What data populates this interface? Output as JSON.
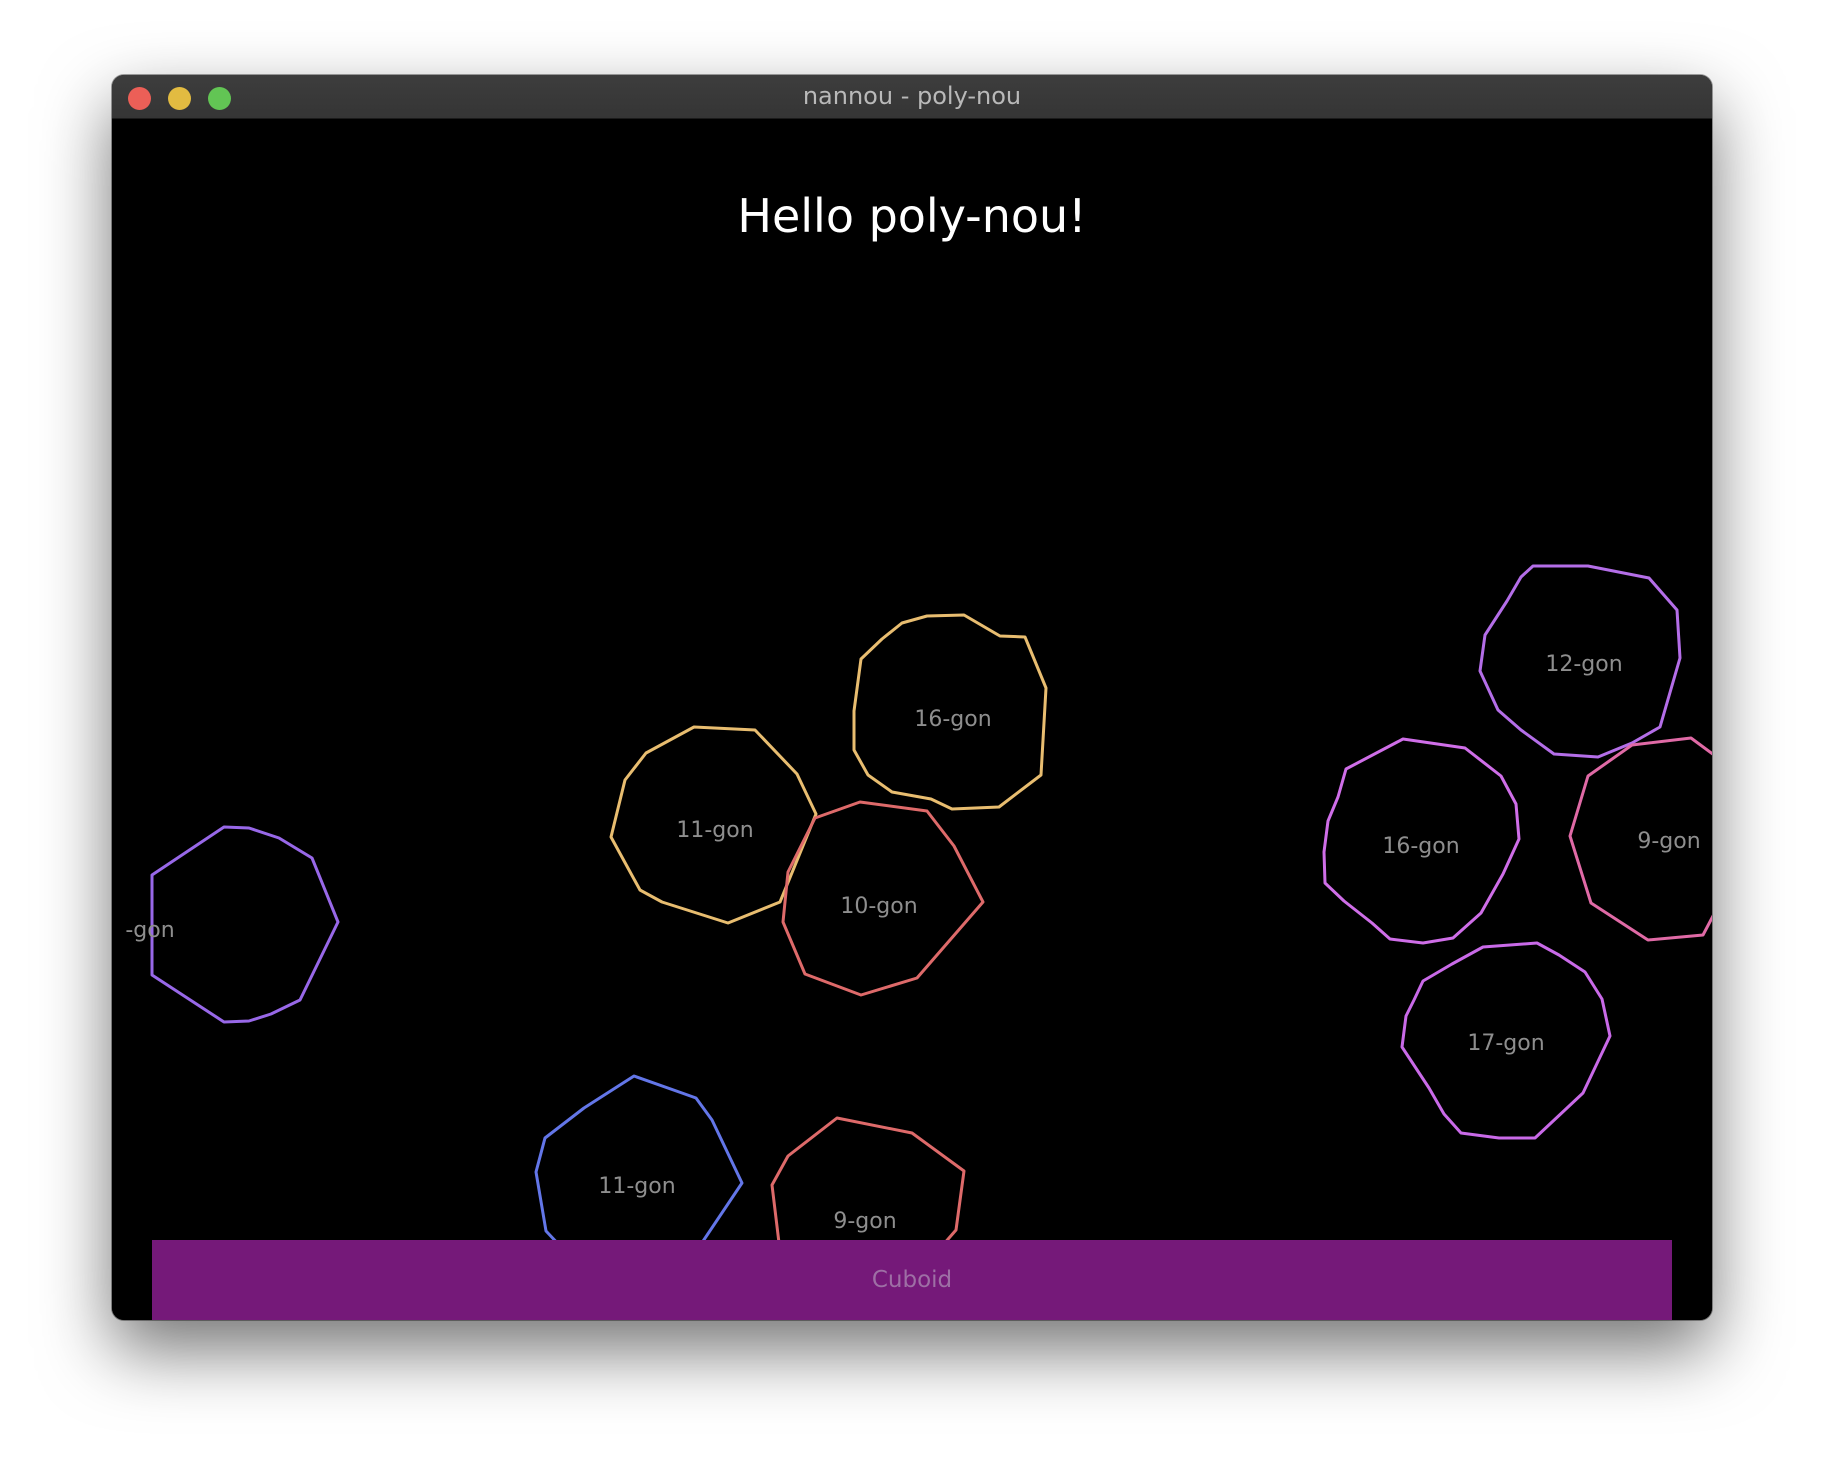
{
  "window": {
    "title": "nannou - poly-nou",
    "traffic_lights": {
      "close_color": "#ec5f57",
      "minimize_color": "#e2bb41",
      "maximize_color": "#62c554"
    }
  },
  "canvas": {
    "background": "#000000",
    "heading": "Hello poly-nou!"
  },
  "polygons": [
    {
      "label": "-gon",
      "color": "#9868e8"
    },
    {
      "label": "11-gon",
      "color": "#e8bd70"
    },
    {
      "label": "16-gon",
      "color": "#e8bd70"
    },
    {
      "label": "10-gon",
      "color": "#de6a6a"
    },
    {
      "label": "11-gon",
      "color": "#6376e8"
    },
    {
      "label": "9-gon",
      "color": "#de6a6a"
    },
    {
      "label": "12-gon",
      "color": "#b46ee8"
    },
    {
      "label": "16-gon",
      "color": "#cf6ee8"
    },
    {
      "label": "9-gon",
      "color": "#e06aa6"
    },
    {
      "label": "17-gon",
      "color": "#c96ae8"
    }
  ],
  "cuboid": {
    "label": "Cuboid",
    "color": "#751979"
  }
}
